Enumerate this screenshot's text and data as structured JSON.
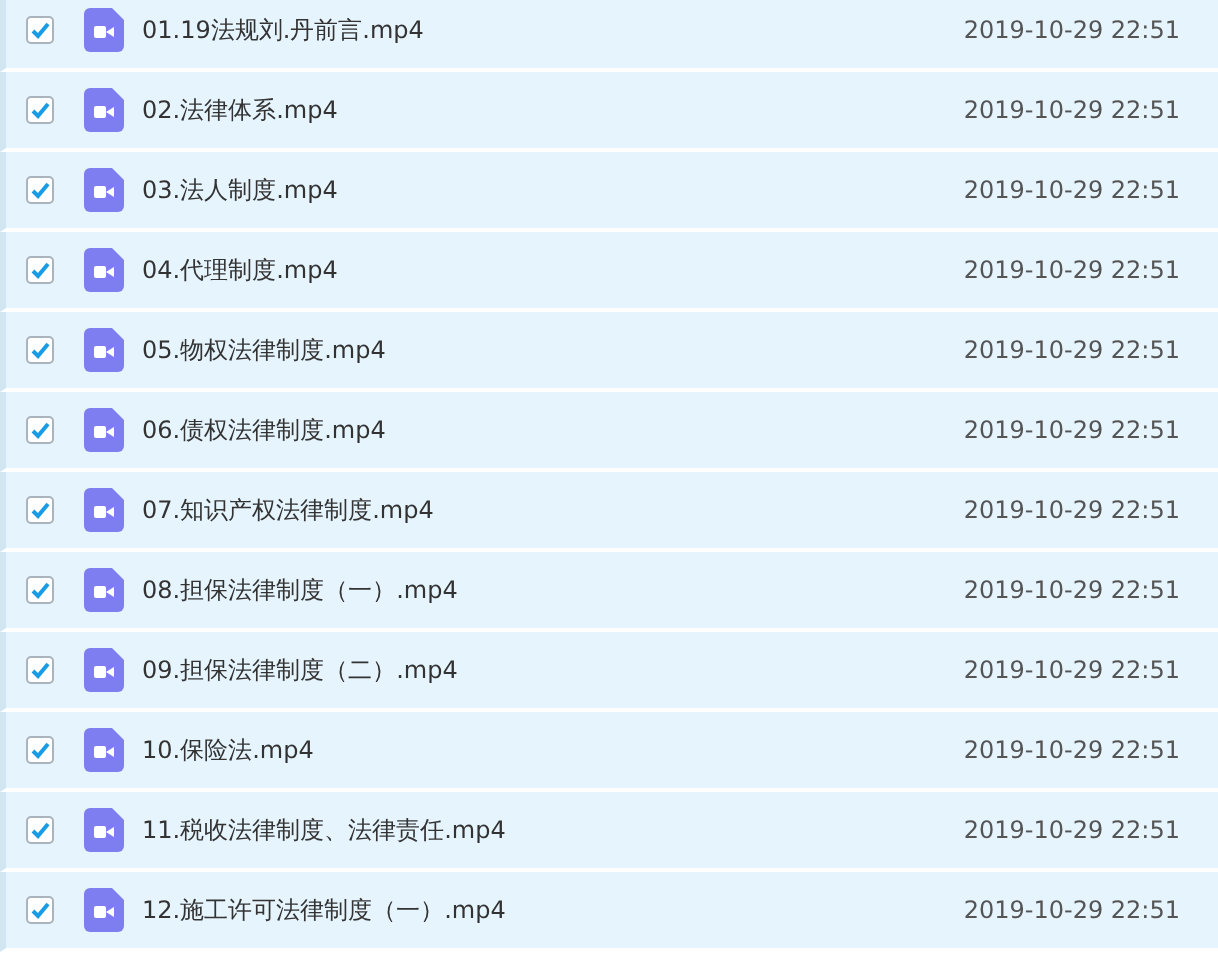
{
  "files": [
    {
      "name": "01.19法规刘.丹前言.mp4",
      "date": "2019-10-29 22:51",
      "checked": true
    },
    {
      "name": "02.法律体系.mp4",
      "date": "2019-10-29 22:51",
      "checked": true
    },
    {
      "name": "03.法人制度.mp4",
      "date": "2019-10-29 22:51",
      "checked": true
    },
    {
      "name": "04.代理制度.mp4",
      "date": "2019-10-29 22:51",
      "checked": true
    },
    {
      "name": "05.物权法律制度.mp4",
      "date": "2019-10-29 22:51",
      "checked": true
    },
    {
      "name": "06.债权法律制度.mp4",
      "date": "2019-10-29 22:51",
      "checked": true
    },
    {
      "name": "07.知识产权法律制度.mp4",
      "date": "2019-10-29 22:51",
      "checked": true
    },
    {
      "name": "08.担保法律制度（一）.mp4",
      "date": "2019-10-29 22:51",
      "checked": true
    },
    {
      "name": "09.担保法律制度（二）.mp4",
      "date": "2019-10-29 22:51",
      "checked": true
    },
    {
      "name": "10.保险法.mp4",
      "date": "2019-10-29 22:51",
      "checked": true
    },
    {
      "name": "11.税收法律制度、法律责任.mp4",
      "date": "2019-10-29 22:51",
      "checked": true
    },
    {
      "name": "12.施工许可法律制度（一）.mp4",
      "date": "2019-10-29 22:51",
      "checked": true
    }
  ]
}
